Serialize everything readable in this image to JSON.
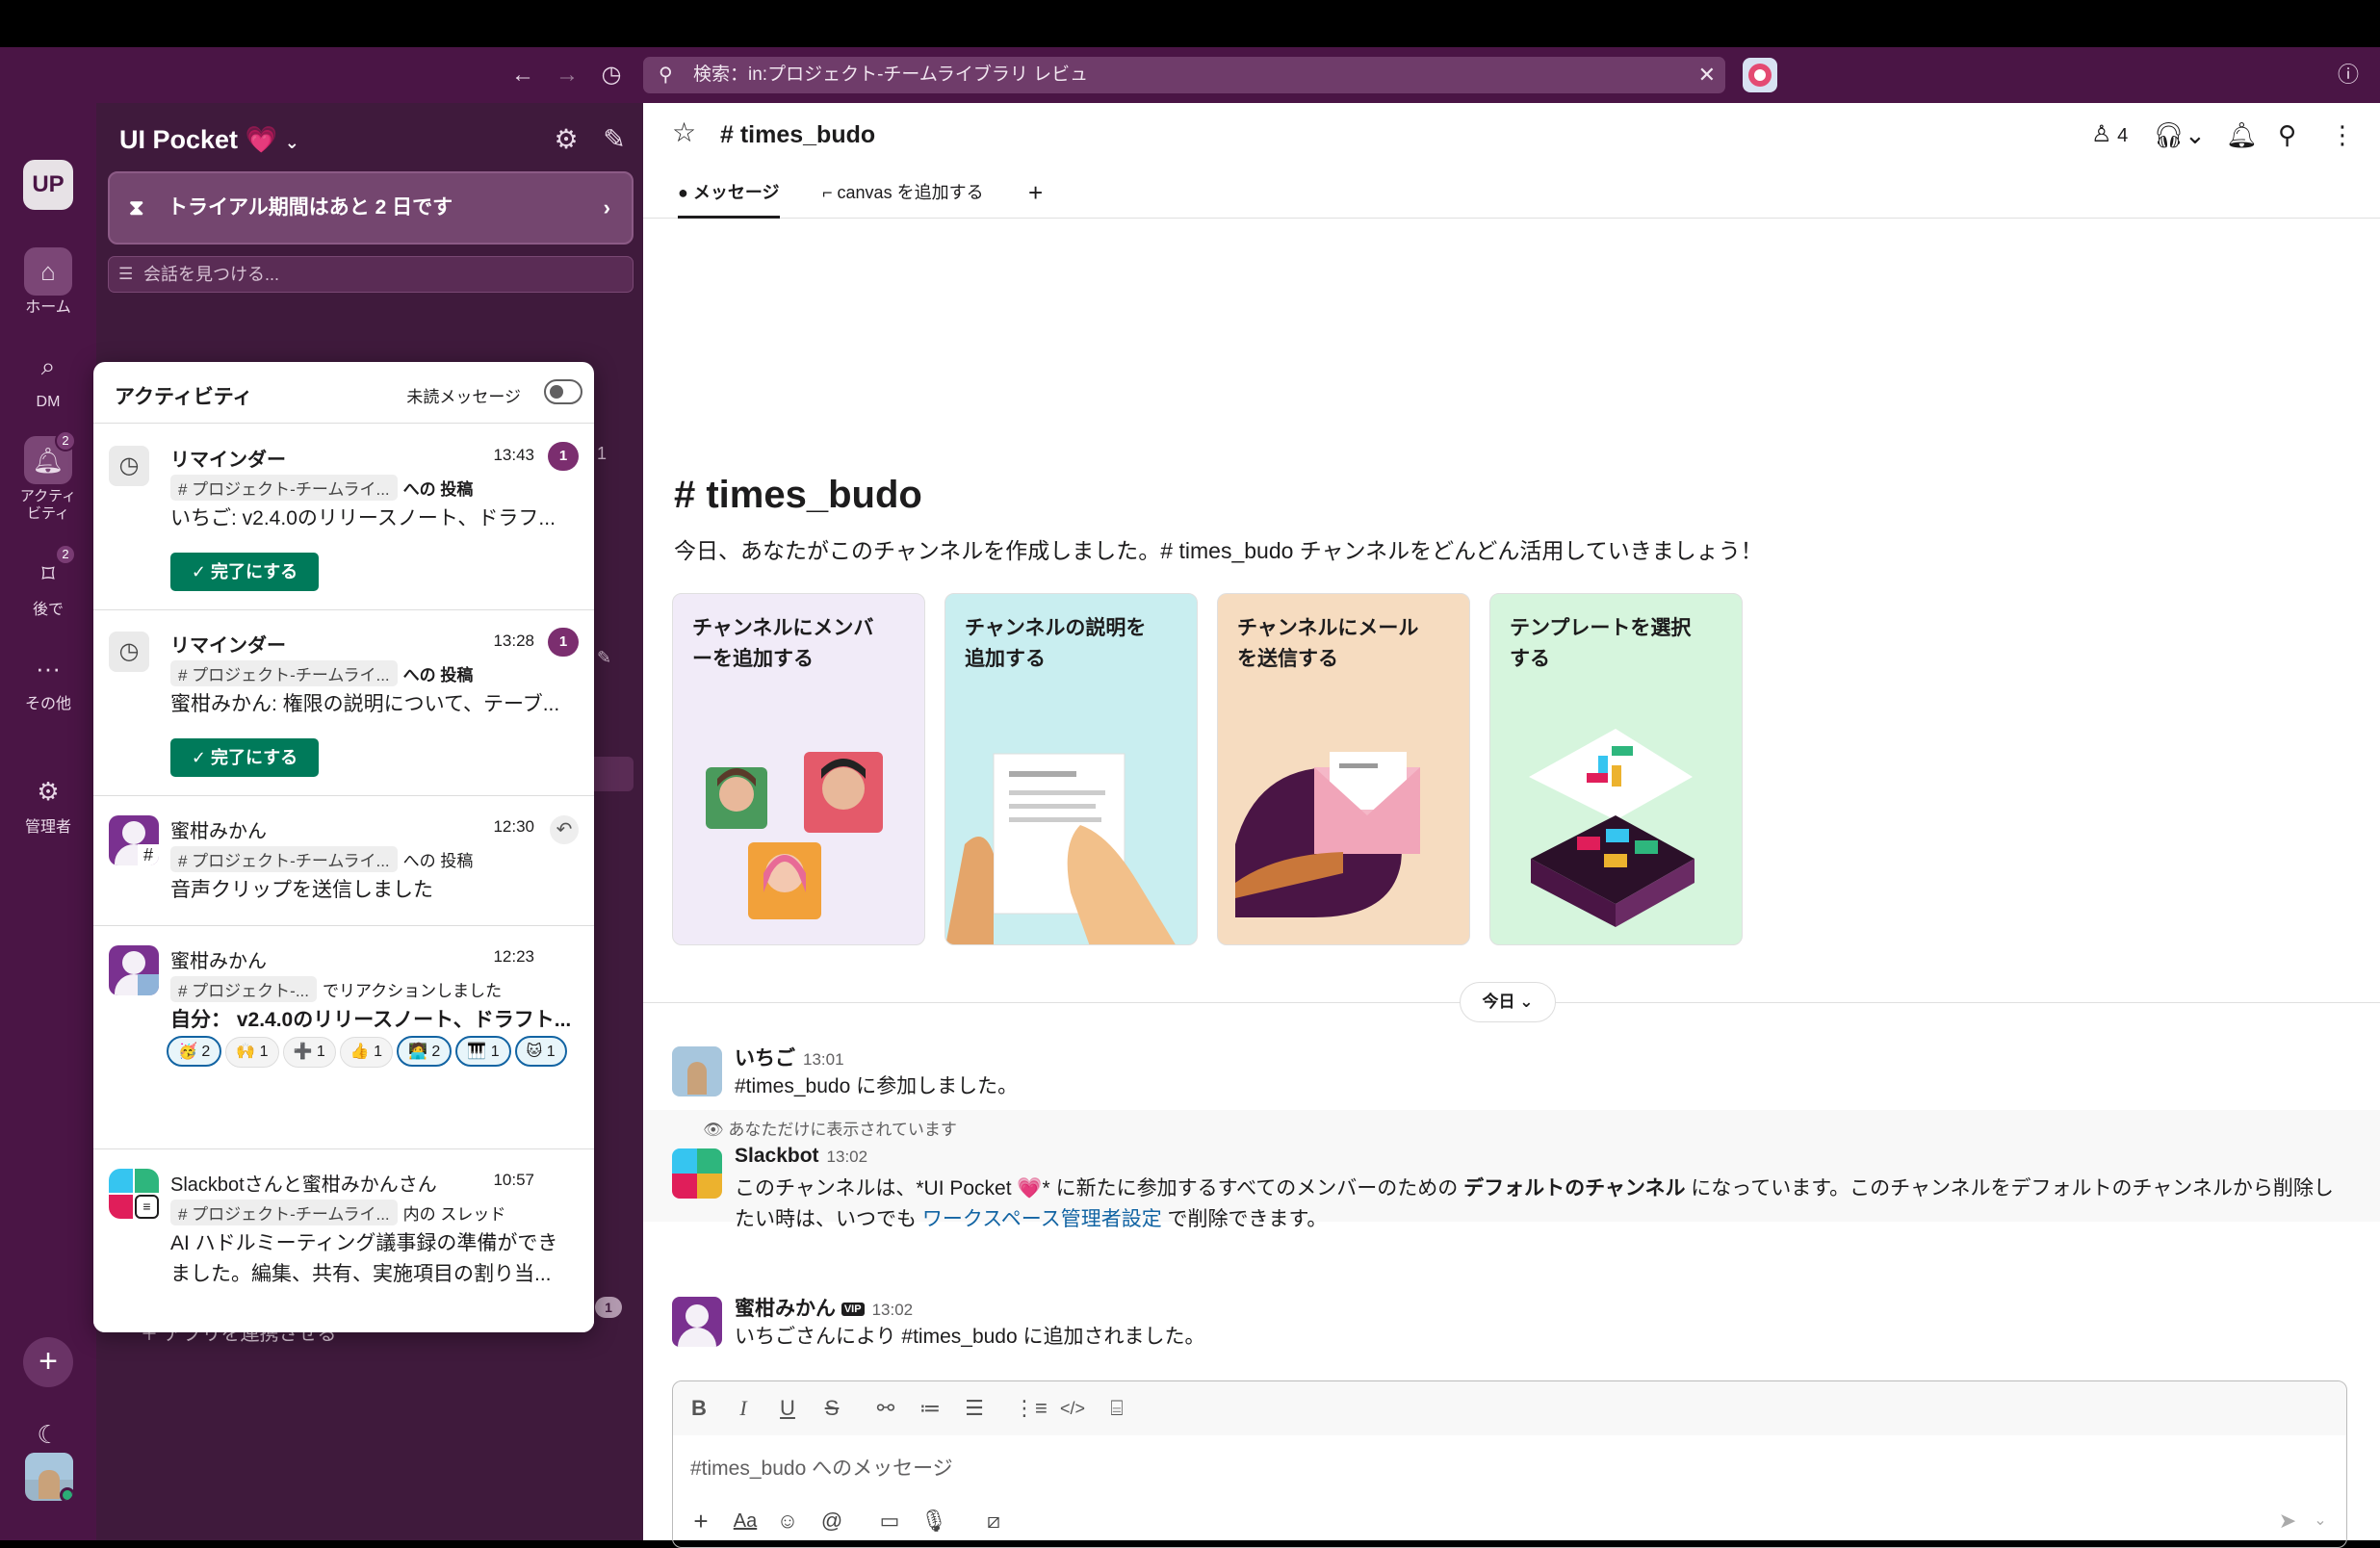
{
  "topbar": {
    "search_text": "検索：in:プロジェクト-チームライブラリ レビュ",
    "icons": [
      "back-arrow-icon",
      "forward-arrow-icon",
      "history-icon",
      "search-icon",
      "clear-icon",
      "help-icon"
    ]
  },
  "workspace": {
    "initials": "UP",
    "name": "UI Pocket 💗",
    "trial_banner": "トライアル期間はあと 2 日です",
    "find_placeholder": "会話を見つける...",
    "apps_link": "アプリを連携させる",
    "ghost_count_1": "1",
    "ghost_count_2": "1"
  },
  "rail": {
    "home": "ホーム",
    "dm": "DM",
    "activity": "アクティビティ",
    "activity_badge": "2",
    "later": "後で",
    "later_badge": "2",
    "more": "その他",
    "admin": "管理者"
  },
  "activity": {
    "title": "アクティビティ",
    "unread_label": "未読メッセージ",
    "items": [
      {
        "title": "リマインダー",
        "time": "13:43",
        "count": "1",
        "chip": "# プロジェクト-チームライ...",
        "suffix": "への 投稿",
        "body": "いちご: v2.4.0のリリースノート、ドラフ...",
        "button": "✓ 完了にする"
      },
      {
        "title": "リマインダー",
        "time": "13:28",
        "count": "1",
        "chip": "# プロジェクト-チームライ...",
        "suffix": "への 投稿",
        "body": "蜜柑みかん: 権限の説明について、テーブ...",
        "button": "✓ 完了にする"
      },
      {
        "title": "蜜柑みかん",
        "time": "12:30",
        "chip": "# プロジェクト-チームライ...",
        "suffix": "への 投稿",
        "body": "音声クリップを送信しました"
      },
      {
        "title": "蜜柑みかん",
        "time": "12:23",
        "chip": "# プロジェクト-...",
        "suffix": "でリアクションしました",
        "body": "自分： v2.4.0のリリースノート、ドラフト...",
        "reactions": [
          "🥳 2",
          "🙌 1",
          "➕ 1",
          "👍 1",
          "🧑‍💻 2",
          "🎹 1",
          "🐱 1"
        ]
      },
      {
        "title": "Slackbotさんと蜜柑みかんさん",
        "time": "10:57",
        "chip": "# プロジェクト-チームライ...",
        "suffix": "内の スレッド",
        "body": "AI ハドルミーティング議事録の準備ができました。編集、共有、実施項目の割り当..."
      }
    ]
  },
  "channel": {
    "name": "# times_budo",
    "member_count": "4",
    "tabs": [
      "メッセージ",
      "canvas を追加する"
    ],
    "intro_title": "# times_budo",
    "intro_desc": "今日、あなたがこのチャンネルを作成しました。# times_budo チャンネルをどんどん活用していきましょう！",
    "cards": [
      "チャンネルにメンバーを追加する",
      "チャンネルの説明を追加する",
      "チャンネルにメールを送信する",
      "テンプレートを選択する"
    ],
    "today": "今日 ⌄"
  },
  "messages": [
    {
      "author": "いちご",
      "time": "13:01",
      "text": "#times_budo に参加しました。"
    },
    {
      "notice": "あなただけに表示されています",
      "author": "Slackbot",
      "time": "13:02",
      "text_a": "このチャンネルは、*UI Pocket 💗* に新たに参加するすべてのメンバーのための ",
      "text_bold": "デフォルトのチャンネル",
      "text_b": " になっています。このチャンネルをデフォルトのチャンネルから削除したい時は、いつでも ",
      "link": "ワークスペース管理者設定",
      "text_c": " で削除できます。"
    },
    {
      "author": "蜜柑みかん",
      "badge": "VIP",
      "time": "13:02",
      "text": "いちごさんにより #times_budo に追加されました。"
    }
  ],
  "composer": {
    "placeholder": "#times_budo へのメッセージ"
  },
  "colors": {
    "aubergine": "#4a1545",
    "sidebar": "#3f1a3c",
    "accent": "#007a5a",
    "badge": "#7b2e6f",
    "link": "#1264a3"
  }
}
